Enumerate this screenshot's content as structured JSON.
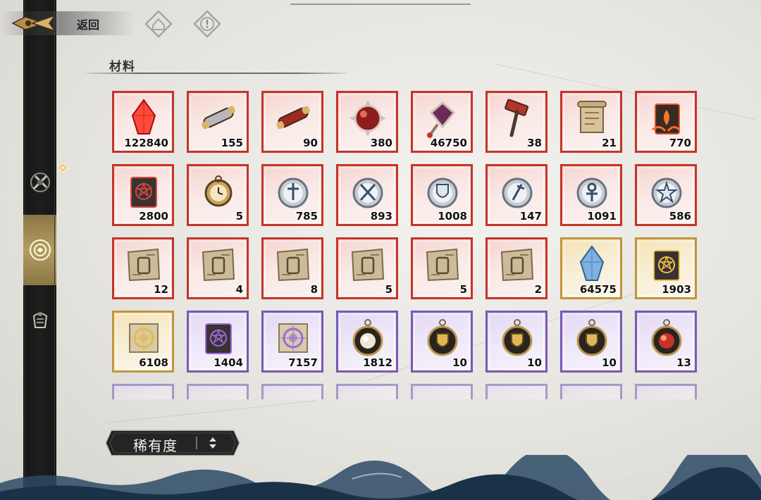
{
  "header": {
    "back_label": "返回"
  },
  "top_icons": [
    "home-diamond-icon",
    "alert-diamond-icon"
  ],
  "sidebar": {
    "tabs": [
      {
        "icon": "weapon-bundle-icon",
        "active": false
      },
      {
        "icon": "material-emblem-icon",
        "active": true
      },
      {
        "icon": "armor-pack-icon",
        "active": false
      }
    ],
    "badge_icon": "notification-diamond-icon"
  },
  "section": {
    "title": "材料"
  },
  "items": [
    {
      "rarity": "red",
      "icon": "red-crystal-icon",
      "count": "122840"
    },
    {
      "rarity": "red",
      "icon": "silver-scroll-case-icon",
      "count": "155"
    },
    {
      "rarity": "red",
      "icon": "red-scroll-case-icon",
      "count": "90"
    },
    {
      "rarity": "red",
      "icon": "red-orb-icon",
      "count": "380"
    },
    {
      "rarity": "red",
      "icon": "gem-amulet-icon",
      "count": "46750"
    },
    {
      "rarity": "red",
      "icon": "war-hammer-icon",
      "count": "38"
    },
    {
      "rarity": "red",
      "icon": "parchment-scroll-icon",
      "count": "21"
    },
    {
      "rarity": "red",
      "icon": "flame-tome-icon",
      "count": "770"
    },
    {
      "rarity": "red",
      "icon": "crimson-sigil-tome-icon",
      "count": "2800"
    },
    {
      "rarity": "red",
      "icon": "pocket-watch-icon",
      "count": "5"
    },
    {
      "rarity": "red",
      "icon": "silver-sword-badge-icon",
      "count": "785"
    },
    {
      "rarity": "red",
      "icon": "crossed-blades-badge-icon",
      "count": "893"
    },
    {
      "rarity": "red",
      "icon": "shield-badge-icon",
      "count": "1008"
    },
    {
      "rarity": "red",
      "icon": "staff-badge-icon",
      "count": "147"
    },
    {
      "rarity": "red",
      "icon": "ankh-badge-icon",
      "count": "1091"
    },
    {
      "rarity": "red",
      "icon": "star-badge-icon",
      "count": "586"
    },
    {
      "rarity": "red",
      "icon": "blueprint-lantern-icon",
      "count": "12"
    },
    {
      "rarity": "red",
      "icon": "blueprint-gear-icon",
      "count": "4"
    },
    {
      "rarity": "red",
      "icon": "blueprint-tools-icon",
      "count": "8"
    },
    {
      "rarity": "red",
      "icon": "blueprint-helmet-icon",
      "count": "5"
    },
    {
      "rarity": "red",
      "icon": "blueprint-jar-icon",
      "count": "5"
    },
    {
      "rarity": "red",
      "icon": "blueprint-chest-icon",
      "count": "2"
    },
    {
      "rarity": "gold",
      "icon": "blue-crystal-icon",
      "count": "64575"
    },
    {
      "rarity": "gold",
      "icon": "gold-sigil-tome-icon",
      "count": "1903"
    },
    {
      "rarity": "gold",
      "icon": "golden-rune-scroll-icon",
      "count": "6108"
    },
    {
      "rarity": "purple",
      "icon": "violet-sigil-tome-icon",
      "count": "1404"
    },
    {
      "rarity": "purple",
      "icon": "violet-rune-scroll-icon",
      "count": "7157"
    },
    {
      "rarity": "purple",
      "icon": "pearl-medallion-icon",
      "count": "1812"
    },
    {
      "rarity": "purple",
      "icon": "gold-shield-medallion-icon",
      "count": "10"
    },
    {
      "rarity": "purple",
      "icon": "gold-shield-medallion-icon",
      "count": "10"
    },
    {
      "rarity": "purple",
      "icon": "gold-shield-medallion-icon",
      "count": "10"
    },
    {
      "rarity": "purple",
      "icon": "ruby-medallion-icon",
      "count": "13"
    }
  ],
  "partial_row": [
    "purple",
    "purple",
    "purple",
    "purple",
    "purple",
    "purple",
    "purple",
    "purple"
  ],
  "sort": {
    "label": "稀有度",
    "icon": "sort-arrows-icon"
  },
  "colors": {
    "red": "#c63328",
    "gold": "#c2953a",
    "purple": "#7a58b6",
    "rail": "#1a1a1a",
    "active_tab": "#b49d62"
  }
}
